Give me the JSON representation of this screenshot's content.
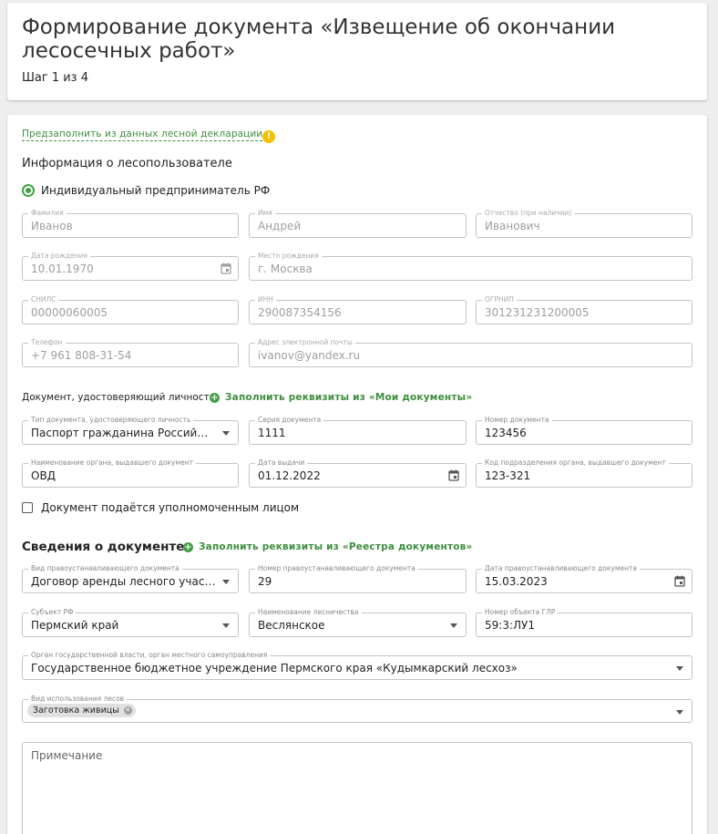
{
  "header": {
    "title": "Формирование документа «Извещение об окончании лесосечных работ»",
    "step": "Шаг 1 из 4"
  },
  "form": {
    "prefill_link": "Предзаполнить из данных лесной декларации",
    "prefill_icon": "warning-icon",
    "user_section": {
      "title": "Информация о лесопользователе",
      "radio_label": "Индивидуальный предприниматель РФ",
      "last_name": {
        "label": "Фамилия",
        "value": "Иванов"
      },
      "first_name": {
        "label": "Имя",
        "value": "Андрей"
      },
      "patronymic": {
        "label": "Отчество (при наличии)",
        "value": "Иванович"
      },
      "birth_date": {
        "label": "Дата рождения",
        "value": "10.01.1970"
      },
      "birth_place": {
        "label": "Место рождения",
        "value": "г. Москва"
      },
      "snils": {
        "label": "СНИЛС",
        "value": "00000060005"
      },
      "inn": {
        "label": "ИНН",
        "value": "290087354156"
      },
      "ogrnip": {
        "label": "ОГРНИП",
        "value": "301231231200005"
      },
      "phone": {
        "label": "Телефон",
        "value": "+7 961 808-31-54"
      },
      "email": {
        "label": "Адрес электронной почты",
        "value": "ivanov@yandex.ru"
      }
    },
    "identity_doc": {
      "title": "Документ, удостоверяющий личность",
      "fill_link": "Заполнить реквизиты из «Мои документы»",
      "doc_type": {
        "label": "Тип документа, удостоверяющего личность",
        "value": "Паспорт гражданина Российск..."
      },
      "series": {
        "label": "Серия документа",
        "value": "1111"
      },
      "number": {
        "label": "Номер документа",
        "value": "123456"
      },
      "issuer": {
        "label": "Наименование органа, выдавшего документ",
        "value": "ОВД"
      },
      "issue_date": {
        "label": "Дата выдачи",
        "value": "01.12.2022"
      },
      "dept_code": {
        "label": "Код подразделения органа, выдавшего документ",
        "value": "123-321"
      },
      "checkbox_label": "Документ подаётся уполномоченным лицом"
    },
    "doc_info": {
      "title": "Сведения о документе",
      "fill_link": "Заполнить реквизиты из «Реестра документов»",
      "basis_type": {
        "label": "Вид правоустанавливающего документа",
        "value": "Договор аренды лесного участка"
      },
      "basis_number": {
        "label": "Номер правоустанавливающего документа",
        "value": "29"
      },
      "basis_date": {
        "label": "Дата правоустанавливающего документа",
        "value": "15.03.2023"
      },
      "region": {
        "label": "Субъект РФ",
        "value": "Пермский край"
      },
      "forestry": {
        "label": "Наименование лесничества",
        "value": "Веслянское"
      },
      "glr_number": {
        "label": "Номер объекта ГЛР",
        "value": "59:3:ЛУ1"
      },
      "authority": {
        "label": "Орган государственной власти, орган местного самоуправления",
        "value": "Государственное бюджетное учреждение Пермского края «Кудымкарский лесхоз»"
      },
      "forest_use": {
        "label": "Вид использования лесов",
        "chips": [
          "Заготовка живицы"
        ]
      },
      "note_placeholder": "Примечание"
    }
  },
  "colors": {
    "accent": "#43a047",
    "link": "#3e8e3e",
    "warning": "#f6c000"
  }
}
